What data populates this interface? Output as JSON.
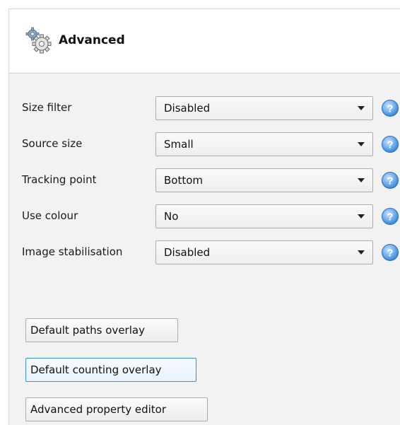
{
  "header": {
    "title": "Advanced",
    "icon": "gear-icon"
  },
  "settings": [
    {
      "label": "Size filter",
      "value": "Disabled"
    },
    {
      "label": "Source size",
      "value": "Small"
    },
    {
      "label": "Tracking point",
      "value": "Bottom"
    },
    {
      "label": "Use colour",
      "value": "No"
    },
    {
      "label": "Image stabilisation",
      "value": "Disabled"
    }
  ],
  "buttons": {
    "paths_overlay": "Default paths overlay",
    "counting_overlay": "Default counting overlay",
    "property_editor": "Advanced property editor"
  },
  "colors": {
    "help_icon": "#2f7fd6",
    "focus_border": "#3c8fd6",
    "panel_background": "#f2f2f2"
  }
}
